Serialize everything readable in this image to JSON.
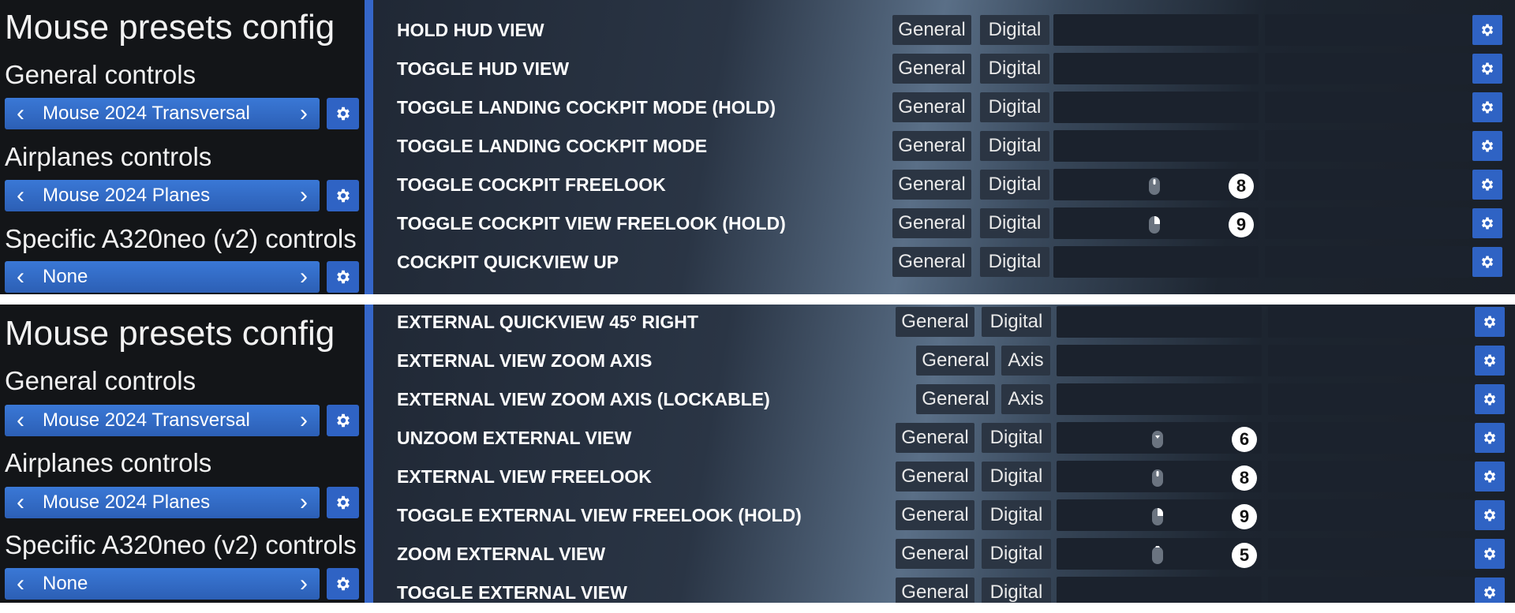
{
  "panels": [
    {
      "sidebar": {
        "title": "Mouse presets config",
        "general_label": "General controls",
        "general_value": "Mouse 2024 Transversal",
        "airplanes_label": "Airplanes controls",
        "airplanes_value": "Mouse 2024 Planes",
        "specific_label": "Specific A320neo (v2) controls",
        "specific_value": "None"
      },
      "rows": [
        {
          "label": "HOLD HUD VIEW",
          "category": "General",
          "type": "Digital"
        },
        {
          "label": "TOGGLE HUD VIEW",
          "category": "General",
          "type": "Digital"
        },
        {
          "label": "TOGGLE LANDING COCKPIT MODE (HOLD)",
          "category": "General",
          "type": "Digital"
        },
        {
          "label": "TOGGLE LANDING COCKPIT MODE",
          "category": "General",
          "type": "Digital"
        },
        {
          "label": "TOGGLE COCKPIT FREELOOK",
          "category": "General",
          "type": "Digital",
          "binding_badge": "8",
          "binding_icon": "mouse-middle-button-icon"
        },
        {
          "label": "TOGGLE COCKPIT VIEW FREELOOK (HOLD)",
          "category": "General",
          "type": "Digital",
          "binding_badge": "9",
          "binding_icon": "mouse-right-button-icon"
        },
        {
          "label": "COCKPIT QUICKVIEW UP",
          "category": "General",
          "type": "Digital"
        }
      ]
    },
    {
      "sidebar": {
        "title": "Mouse presets config",
        "general_label": "General controls",
        "general_value": "Mouse 2024 Transversal",
        "airplanes_label": "Airplanes controls",
        "airplanes_value": "Mouse 2024 Planes",
        "specific_label": "Specific A320neo (v2) controls",
        "specific_value": "None"
      },
      "rows": [
        {
          "label": "EXTERNAL QUICKVIEW 45° RIGHT",
          "category": "General",
          "type": "Digital"
        },
        {
          "label": "EXTERNAL VIEW ZOOM AXIS",
          "category": "General",
          "type": "Axis"
        },
        {
          "label": "EXTERNAL VIEW ZOOM AXIS (LOCKABLE)",
          "category": "General",
          "type": "Axis"
        },
        {
          "label": "UNZOOM EXTERNAL VIEW",
          "category": "General",
          "type": "Digital",
          "binding_badge": "6",
          "binding_icon": "mouse-wheel-down-icon"
        },
        {
          "label": "EXTERNAL VIEW FREELOOK",
          "category": "General",
          "type": "Digital",
          "binding_badge": "8",
          "binding_icon": "mouse-middle-button-icon"
        },
        {
          "label": "TOGGLE EXTERNAL VIEW FREELOOK (HOLD)",
          "category": "General",
          "type": "Digital",
          "binding_badge": "9",
          "binding_icon": "mouse-right-button-icon"
        },
        {
          "label": "ZOOM EXTERNAL VIEW",
          "category": "General",
          "type": "Digital",
          "binding_badge": "5",
          "binding_icon": "mouse-wheel-up-icon"
        },
        {
          "label": "TOGGLE EXTERNAL VIEW",
          "category": "General",
          "type": "Digital"
        }
      ]
    }
  ],
  "colors": {
    "accent": "#3566c8",
    "selector": "#2f63c4",
    "background": "#121417",
    "slot": "#1b222d",
    "tag": "#2b3543"
  }
}
